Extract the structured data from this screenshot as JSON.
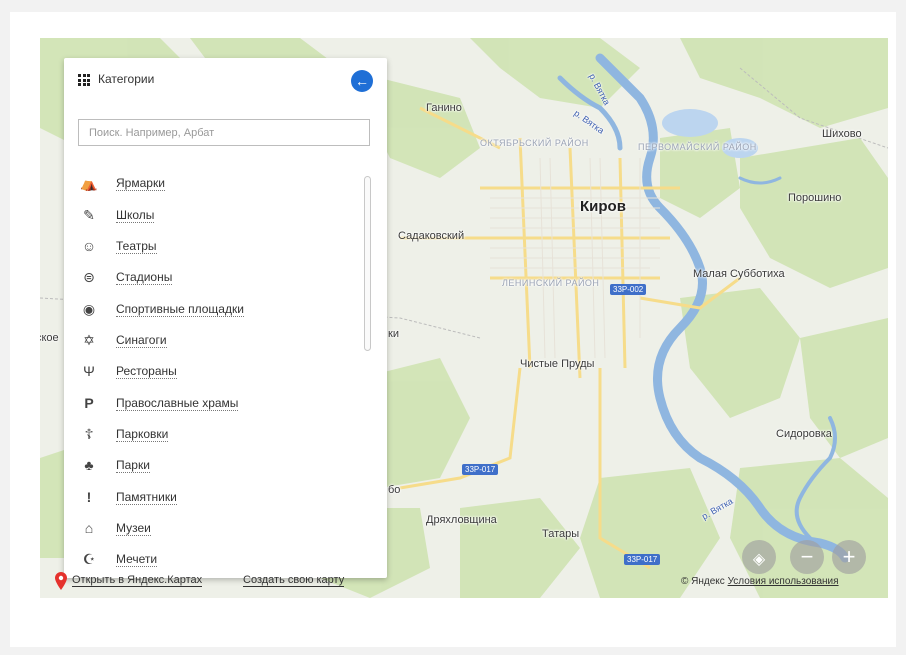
{
  "panel": {
    "title": "Категории",
    "search_placeholder": "Поиск. Например, Арбат",
    "categories": [
      {
        "label": "Ярмарки",
        "icon": "fair-icon",
        "glyph": "⛺"
      },
      {
        "label": "Школы",
        "icon": "school-icon",
        "glyph": "✎"
      },
      {
        "label": "Театры",
        "icon": "theater-icon",
        "glyph": "☺"
      },
      {
        "label": "Стадионы",
        "icon": "stadium-icon",
        "glyph": "⊜"
      },
      {
        "label": "Спортивные площадки",
        "icon": "sports-ground-icon",
        "glyph": "◉"
      },
      {
        "label": "Синагоги",
        "icon": "star-of-david-icon",
        "glyph": "✡"
      },
      {
        "label": "Рестораны",
        "icon": "fork-knife-icon",
        "glyph": "Ψ"
      },
      {
        "label": "Православные храмы",
        "icon": "parking-icon",
        "glyph": "P"
      },
      {
        "label": "Парковки",
        "icon": "orthodox-cross-icon",
        "glyph": "☦"
      },
      {
        "label": "Парки",
        "icon": "tree-icon",
        "glyph": "♣"
      },
      {
        "label": "Памятники",
        "icon": "monument-icon",
        "glyph": "!"
      },
      {
        "label": "Музеи",
        "icon": "museum-icon",
        "glyph": "⌂"
      },
      {
        "label": "Мечети",
        "icon": "crescent-icon",
        "glyph": "☪"
      }
    ]
  },
  "map": {
    "city": "Киров",
    "places": [
      "Ганино",
      "Шихово",
      "Порошино",
      "Садаковский",
      "Малая Субботиха",
      "Чистые Пруды",
      "Сидоровка",
      "Дряхловщина",
      "Татары"
    ],
    "districts": [
      "ОКТЯБРЬСКИЙ РАЙОН",
      "ПЕРВОМАЙСКИЙ РАЙОН",
      "ЛЕНИНСКИЙ РАЙОН"
    ],
    "rivers": [
      "р. Вятка",
      "р. Вятка",
      "р. Вятка"
    ],
    "road_badges": [
      "33Р-002",
      "33Р-017",
      "33Р-017"
    ],
    "edge_text": [
      "ское",
      "ки",
      "бо"
    ]
  },
  "footer": {
    "open_link": "Открыть в Яндекс.Картах",
    "create_link": "Создать свою карту",
    "copyright": "© Яндекс",
    "terms_link": "Условия использования"
  },
  "controls": {
    "zoom_out": "−",
    "zoom_in": "+"
  },
  "colors": {
    "accent": "#1f6fd6",
    "river": "#7aa7d8",
    "park": "#cfe3b2",
    "road": "#f4d27a"
  }
}
